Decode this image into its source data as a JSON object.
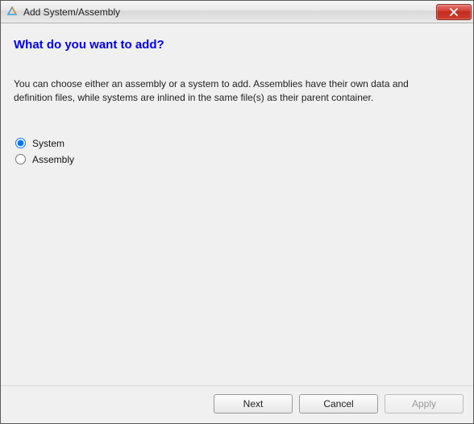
{
  "window": {
    "title": "Add System/Assembly"
  },
  "heading": "What do you want to add?",
  "description": "You can choose either an assembly or a system to add. Assemblies have their own data and definition files, while systems are inlined in the same file(s) as their parent container.",
  "options": {
    "system": {
      "label": "System",
      "selected": true
    },
    "assembly": {
      "label": "Assembly",
      "selected": false
    }
  },
  "buttons": {
    "next": "Next",
    "cancel": "Cancel",
    "apply": "Apply"
  },
  "apply_enabled": false
}
